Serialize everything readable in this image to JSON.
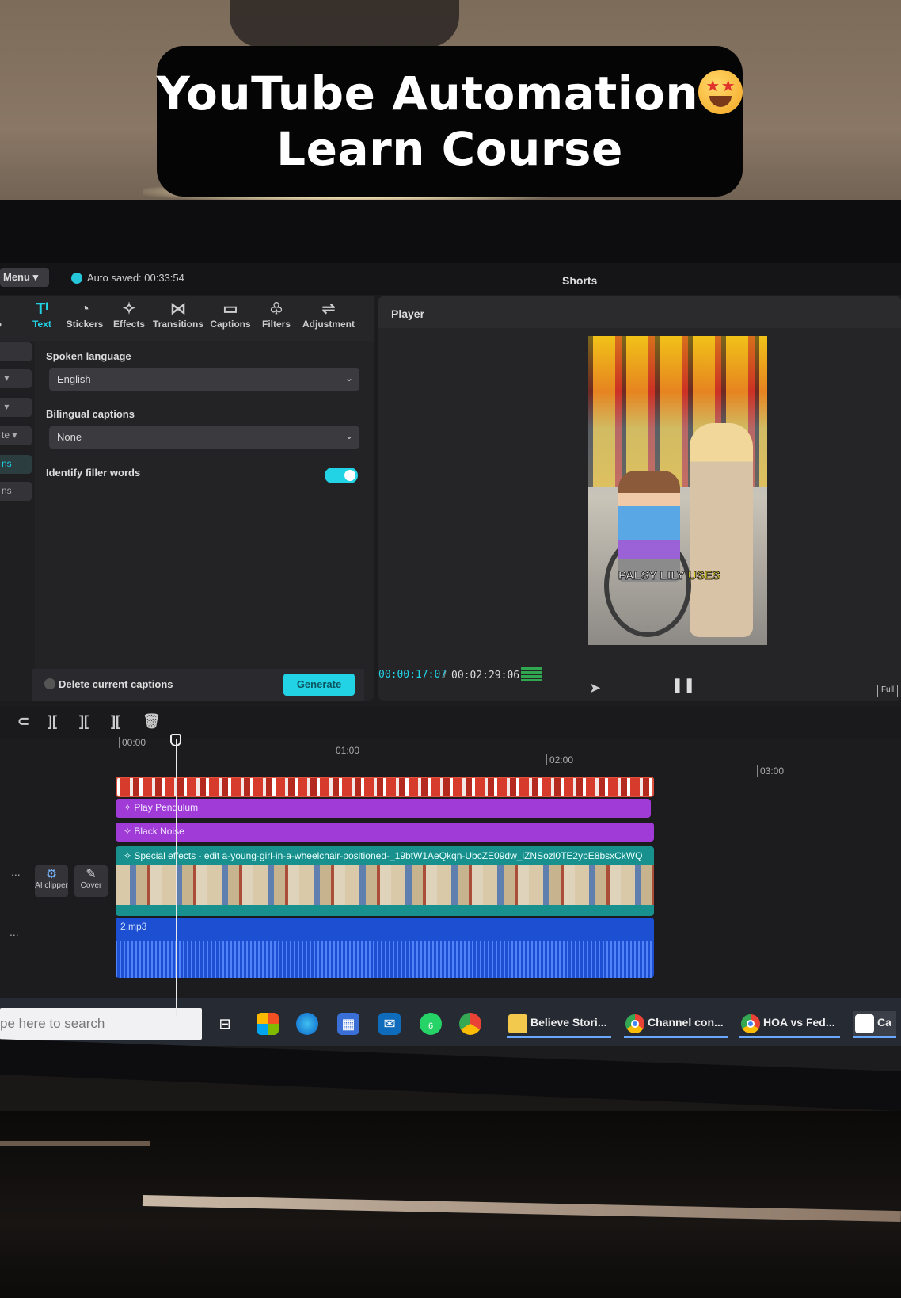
{
  "overlay": {
    "line1": "YouTube Automation",
    "line2": "Learn Course",
    "emoji": "star-struck-emoji"
  },
  "topbar": {
    "menu_label": "Menu",
    "autosave": "Auto saved: 00:33:54",
    "project_title": "Shorts"
  },
  "toolbar": {
    "items": [
      {
        "label": "dio",
        "icon": "audio-icon"
      },
      {
        "label": "Text",
        "icon": "text-icon"
      },
      {
        "label": "Stickers",
        "icon": "sticker-icon"
      },
      {
        "label": "Effects",
        "icon": "effects-icon"
      },
      {
        "label": "Transitions",
        "icon": "transition-icon"
      },
      {
        "label": "Captions",
        "icon": "captions-icon"
      },
      {
        "label": "Filters",
        "icon": "filters-icon"
      },
      {
        "label": "Adjustment",
        "icon": "adjustment-icon"
      }
    ]
  },
  "side_nav": {
    "items": [
      "te",
      "ns",
      "ns"
    ]
  },
  "captions_form": {
    "spoken_language_label": "Spoken language",
    "spoken_language_value": "English",
    "bilingual_label": "Bilingual captions",
    "bilingual_value": "None",
    "filler_label": "Identify filler words",
    "filler_enabled": true,
    "delete_label": "Delete current captions",
    "generate_label": "Generate"
  },
  "player": {
    "title": "Player",
    "caption_word1": "PALSY LILY",
    "caption_word2": "USES",
    "current_time": "00:00:17:07",
    "separator": "/",
    "total_time": "00:02:29:06",
    "full_label": "Full"
  },
  "timeline": {
    "ticks": [
      "00:00",
      "01:00",
      "02:00",
      "03:00"
    ],
    "effect1": "Play Pendulum",
    "effect2": "Black Noise",
    "video_label": "Special effects - edit   a-young-girl-in-a-wheelchair-positioned-_19btW1AeQkqn-UbcZE09dw_iZNSozl0TE2ybE8bsxCkWQ",
    "audio_label": "2.mp3",
    "ai_clipper_label": "AI clipper",
    "cover_label": "Cover",
    "more": "..."
  },
  "taskbar": {
    "search_placeholder": "pe here to search",
    "apps": [
      {
        "label": "Believe Stori...",
        "icon": "file-explorer-icon"
      },
      {
        "label": "Channel con...",
        "icon": "chrome-icon"
      },
      {
        "label": "HOA vs Fed...",
        "icon": "chrome-icon"
      },
      {
        "label": "Ca",
        "icon": "capcut-icon"
      }
    ],
    "whatsapp_badge": "6"
  },
  "colors": {
    "accent": "#22d3e6",
    "effect_clip": "#a13bd8",
    "video_clip": "#18918e",
    "audio_clip": "#1c4fd1"
  }
}
